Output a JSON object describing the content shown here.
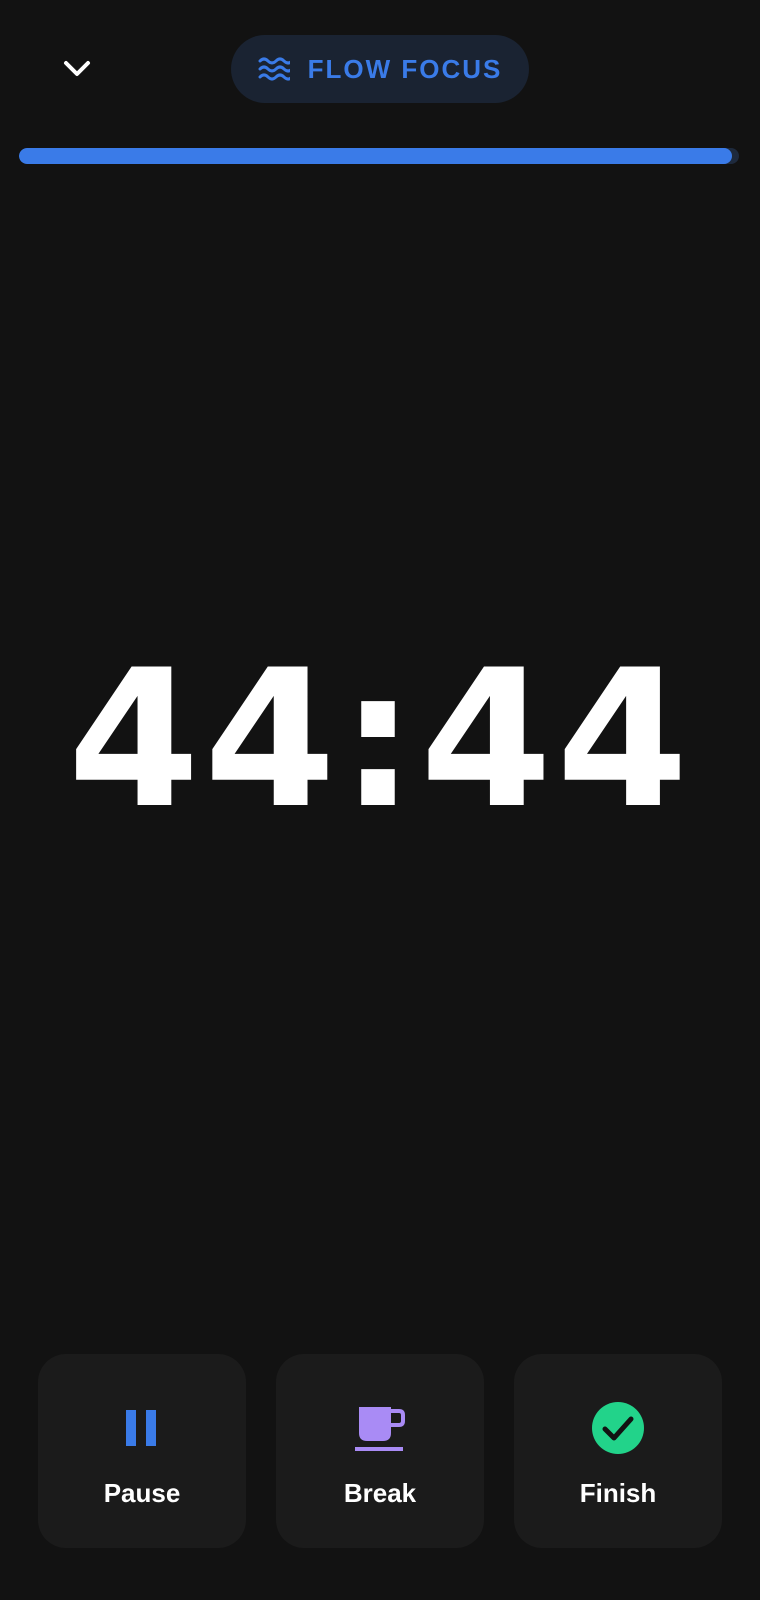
{
  "header": {
    "mode_label": "FLOW FOCUS",
    "mode_icon": "waves-icon",
    "collapse_icon": "chevron-down-icon"
  },
  "progress": {
    "fraction": 0.99
  },
  "timer": {
    "display": "44:44"
  },
  "actions": [
    {
      "label": "Pause",
      "icon": "pause-icon",
      "color": "#3a7be8"
    },
    {
      "label": "Break",
      "icon": "coffee-cup-icon",
      "color": "#a98bf5"
    },
    {
      "label": "Finish",
      "icon": "check-circle-icon",
      "color": "#22d38a"
    }
  ],
  "colors": {
    "background": "#121212",
    "accent": "#3a7be8",
    "card": "#1b1b1b"
  }
}
